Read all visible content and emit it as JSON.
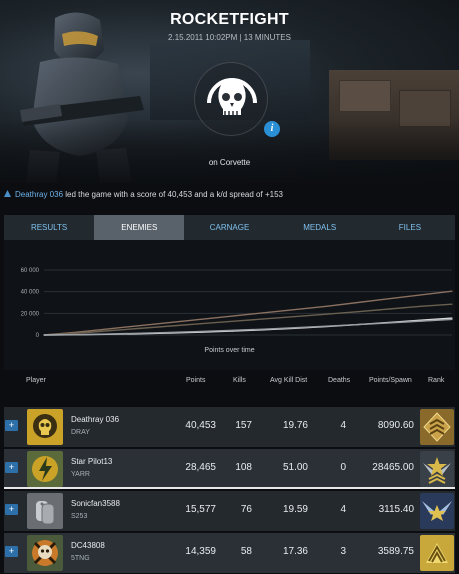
{
  "game": {
    "title": "ROCKETFIGHT",
    "subtitle": "2.15.2011 10:02PM | 13 MINUTES",
    "map": "on Corvette",
    "info_icon": "i"
  },
  "summary": {
    "player": "Deathray 036",
    "text": "led the game with a score of 40,453 and a k/d spread of +153"
  },
  "tabs": [
    {
      "label": "RESULTS",
      "active": false
    },
    {
      "label": "ENEMIES",
      "active": true
    },
    {
      "label": "CARNAGE",
      "active": false
    },
    {
      "label": "MEDALS",
      "active": false
    },
    {
      "label": "FILES",
      "active": false
    }
  ],
  "chart_data": {
    "type": "line",
    "xlabel": "Points over time",
    "ylim": [
      0,
      60000
    ],
    "yticks": [
      "60 000",
      "40 000",
      "20 000",
      "0"
    ],
    "x": [
      0,
      1,
      2,
      3,
      4,
      5,
      6,
      7,
      8,
      9,
      10,
      11,
      12,
      13
    ],
    "series": [
      {
        "color": "#8a7060",
        "values": [
          0,
          2500,
          5500,
          8500,
          11500,
          14500,
          17500,
          20500,
          23500,
          26500,
          30000,
          33500,
          37000,
          40453
        ]
      },
      {
        "color": "#6a6050",
        "values": [
          0,
          1500,
          3800,
          6000,
          8200,
          10400,
          12600,
          14800,
          17000,
          19200,
          21500,
          24000,
          26500,
          28465
        ]
      },
      {
        "color": "#d8d8d8",
        "values": [
          0,
          200,
          600,
          1100,
          1800,
          2600,
          3600,
          4800,
          6200,
          7800,
          9600,
          11600,
          13700,
          15577
        ]
      },
      {
        "color": "#9aa0a6",
        "values": [
          0,
          300,
          900,
          1600,
          2400,
          3300,
          4300,
          5400,
          6700,
          8100,
          9600,
          11200,
          12800,
          14359
        ]
      }
    ]
  },
  "table": {
    "headers": {
      "player": "Player",
      "points": "Points",
      "kills": "Kills",
      "avg_kill_dist": "Avg Kill Dist",
      "deaths": "Deaths",
      "points_spawn": "Points/Spawn",
      "rank": "Rank"
    },
    "rows": [
      {
        "name": "Deathray 036",
        "tag": "DRAY",
        "points": "40,453",
        "kills": "157",
        "avg_kill_dist": "19.76",
        "deaths": "4",
        "points_spawn": "8090.60",
        "emblem": "skull-emblem-icon",
        "rank": "gold-chevron-rank-icon",
        "expand": "+"
      },
      {
        "name": "Star Pilot13",
        "tag": "YARR",
        "points": "28,465",
        "kills": "108",
        "avg_kill_dist": "51.00",
        "deaths": "0",
        "points_spawn": "28465.00",
        "emblem": "lightning-emblem-icon",
        "rank": "winged-star-rank-icon",
        "expand": "+"
      },
      {
        "name": "Sonicfan3588",
        "tag": "S253",
        "points": "15,577",
        "kills": "76",
        "avg_kill_dist": "19.59",
        "deaths": "4",
        "points_spawn": "3115.40",
        "emblem": "dog-tags-emblem-icon",
        "rank": "blue-wings-rank-icon",
        "expand": "+"
      },
      {
        "name": "DC43808",
        "tag": "5TNG",
        "points": "14,359",
        "kills": "58",
        "avg_kill_dist": "17.36",
        "deaths": "3",
        "points_spawn": "3589.75",
        "emblem": "crossed-skull-emblem-icon",
        "rank": "gold-chevron-rank-icon",
        "expand": "+"
      }
    ]
  }
}
